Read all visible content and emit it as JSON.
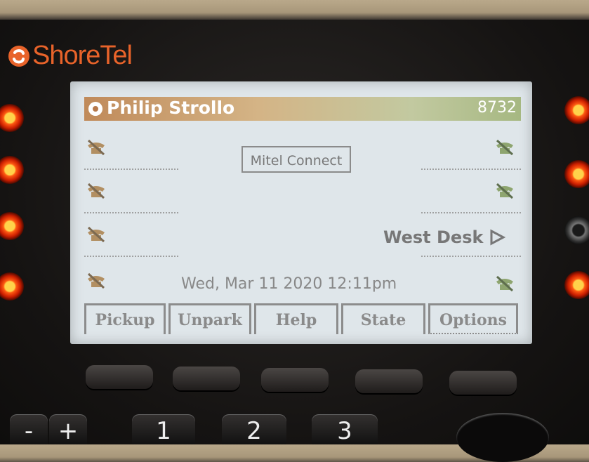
{
  "brand": "ShoreTel",
  "screen": {
    "header": {
      "user_name": "Philip Strollo",
      "extension": "8732"
    },
    "app_label": "Mitel Connect",
    "line_label": "West Desk",
    "datetime": "Wed, Mar 11 2020 12:11pm",
    "softkeys": [
      "Pickup",
      "Unpark",
      "Help",
      "State",
      "Options"
    ]
  },
  "keypad": [
    "-",
    "+",
    "1",
    "2",
    "3"
  ],
  "colors": {
    "lamp_on": "#ff5a12",
    "brand": "#e8632a",
    "header": "#c08a5a"
  }
}
